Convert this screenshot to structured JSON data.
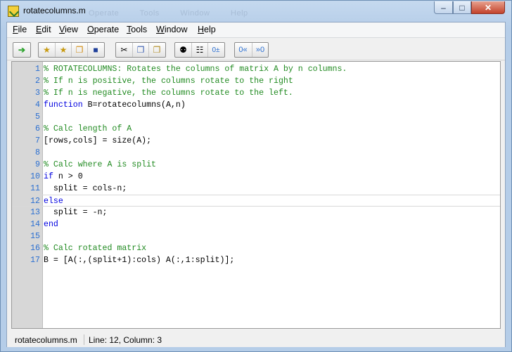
{
  "window": {
    "title": "rotatecolumns.m",
    "ghost_menu": [
      "Operate",
      "Tools",
      "Window",
      "Help"
    ],
    "min_glyph": "–",
    "max_glyph": "□",
    "close_glyph": "✕"
  },
  "menubar": {
    "items": [
      {
        "u": "F",
        "rest": "ile"
      },
      {
        "u": "E",
        "rest": "dit"
      },
      {
        "u": "V",
        "rest": "iew"
      },
      {
        "u": "O",
        "rest": "perate"
      },
      {
        "u": "T",
        "rest": "ools"
      },
      {
        "u": "W",
        "rest": "indow"
      },
      {
        "u": "H",
        "rest": "elp"
      }
    ]
  },
  "toolbar": {
    "run_glyph": "➔",
    "file_glyphs": [
      "★",
      "★",
      "❐",
      "■"
    ],
    "edit_glyphs": [
      "✂",
      "❐",
      "❐"
    ],
    "find_glyphs": [
      "⚉",
      "☷",
      "0±"
    ],
    "indent_glyphs": [
      "0«",
      "»0"
    ]
  },
  "editor": {
    "current_line": 12,
    "lines": [
      {
        "n": "1",
        "type": "comment",
        "text": "% ROTATECOLUMNS: Rotates the columns of matrix A by n columns."
      },
      {
        "n": "2",
        "type": "comment",
        "text": "% If n is positive, the columns rotate to the right"
      },
      {
        "n": "3",
        "type": "comment",
        "text": "% If n is negative, the columns rotate to the left."
      },
      {
        "n": "4",
        "type": "mixed",
        "kw": "function",
        "text": " B=rotatecolumns(A,n)"
      },
      {
        "n": "5",
        "type": "plain",
        "text": ""
      },
      {
        "n": "6",
        "type": "comment",
        "text": "% Calc length of A"
      },
      {
        "n": "7",
        "type": "plain",
        "text": "[rows,cols] = size(A);"
      },
      {
        "n": "8",
        "type": "plain",
        "text": ""
      },
      {
        "n": "9",
        "type": "comment",
        "text": "% Calc where A is split"
      },
      {
        "n": "10",
        "type": "mixed",
        "kw": "if",
        "text": " n > 0"
      },
      {
        "n": "11",
        "type": "plain",
        "text": "  split = cols-n;"
      },
      {
        "n": "12",
        "type": "mixed",
        "kw": "else",
        "text": ""
      },
      {
        "n": "13",
        "type": "plain",
        "text": "  split = -n;"
      },
      {
        "n": "14",
        "type": "mixed",
        "kw": "end",
        "text": ""
      },
      {
        "n": "15",
        "type": "plain",
        "text": ""
      },
      {
        "n": "16",
        "type": "comment",
        "text": "% Calc rotated matrix"
      },
      {
        "n": "17",
        "type": "plain",
        "text": "B = [A(:,(split+1):cols) A(:,1:split)];"
      }
    ]
  },
  "status": {
    "file": "rotatecolumns.m",
    "position": "Line: 12, Column: 3"
  }
}
